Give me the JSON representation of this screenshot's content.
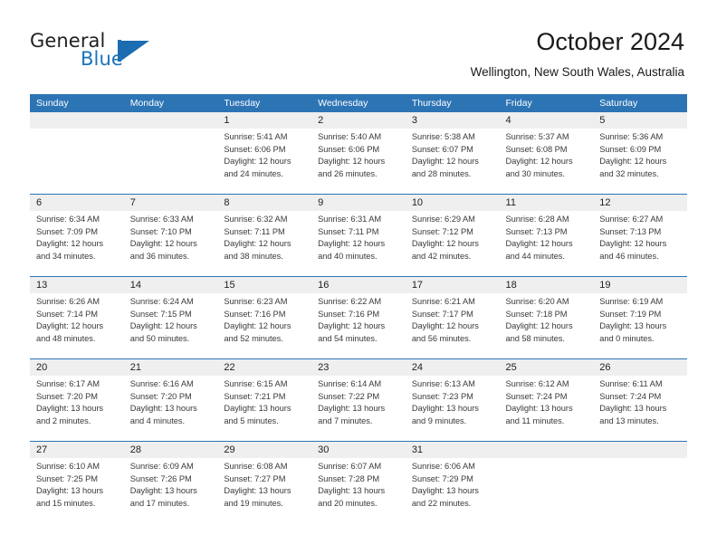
{
  "brand": {
    "name_part1": "General",
    "name_part2": "Blue",
    "logo_icon": "flag-triangle-icon",
    "accent_color": "#1b74bb"
  },
  "header": {
    "title": "October 2024",
    "subtitle": "Wellington, New South Wales, Australia"
  },
  "colors": {
    "header_blue": "#2d74b5",
    "daynum_band": "#efefef",
    "text": "#3a3a3a"
  },
  "weekdays": [
    "Sunday",
    "Monday",
    "Tuesday",
    "Wednesday",
    "Thursday",
    "Friday",
    "Saturday"
  ],
  "weeks": [
    [
      {
        "day": "",
        "lines": []
      },
      {
        "day": "",
        "lines": []
      },
      {
        "day": "1",
        "lines": [
          "Sunrise: 5:41 AM",
          "Sunset: 6:06 PM",
          "Daylight: 12 hours",
          "and 24 minutes."
        ]
      },
      {
        "day": "2",
        "lines": [
          "Sunrise: 5:40 AM",
          "Sunset: 6:06 PM",
          "Daylight: 12 hours",
          "and 26 minutes."
        ]
      },
      {
        "day": "3",
        "lines": [
          "Sunrise: 5:38 AM",
          "Sunset: 6:07 PM",
          "Daylight: 12 hours",
          "and 28 minutes."
        ]
      },
      {
        "day": "4",
        "lines": [
          "Sunrise: 5:37 AM",
          "Sunset: 6:08 PM",
          "Daylight: 12 hours",
          "and 30 minutes."
        ]
      },
      {
        "day": "5",
        "lines": [
          "Sunrise: 5:36 AM",
          "Sunset: 6:09 PM",
          "Daylight: 12 hours",
          "and 32 minutes."
        ]
      }
    ],
    [
      {
        "day": "6",
        "lines": [
          "Sunrise: 6:34 AM",
          "Sunset: 7:09 PM",
          "Daylight: 12 hours",
          "and 34 minutes."
        ]
      },
      {
        "day": "7",
        "lines": [
          "Sunrise: 6:33 AM",
          "Sunset: 7:10 PM",
          "Daylight: 12 hours",
          "and 36 minutes."
        ]
      },
      {
        "day": "8",
        "lines": [
          "Sunrise: 6:32 AM",
          "Sunset: 7:11 PM",
          "Daylight: 12 hours",
          "and 38 minutes."
        ]
      },
      {
        "day": "9",
        "lines": [
          "Sunrise: 6:31 AM",
          "Sunset: 7:11 PM",
          "Daylight: 12 hours",
          "and 40 minutes."
        ]
      },
      {
        "day": "10",
        "lines": [
          "Sunrise: 6:29 AM",
          "Sunset: 7:12 PM",
          "Daylight: 12 hours",
          "and 42 minutes."
        ]
      },
      {
        "day": "11",
        "lines": [
          "Sunrise: 6:28 AM",
          "Sunset: 7:13 PM",
          "Daylight: 12 hours",
          "and 44 minutes."
        ]
      },
      {
        "day": "12",
        "lines": [
          "Sunrise: 6:27 AM",
          "Sunset: 7:13 PM",
          "Daylight: 12 hours",
          "and 46 minutes."
        ]
      }
    ],
    [
      {
        "day": "13",
        "lines": [
          "Sunrise: 6:26 AM",
          "Sunset: 7:14 PM",
          "Daylight: 12 hours",
          "and 48 minutes."
        ]
      },
      {
        "day": "14",
        "lines": [
          "Sunrise: 6:24 AM",
          "Sunset: 7:15 PM",
          "Daylight: 12 hours",
          "and 50 minutes."
        ]
      },
      {
        "day": "15",
        "lines": [
          "Sunrise: 6:23 AM",
          "Sunset: 7:16 PM",
          "Daylight: 12 hours",
          "and 52 minutes."
        ]
      },
      {
        "day": "16",
        "lines": [
          "Sunrise: 6:22 AM",
          "Sunset: 7:16 PM",
          "Daylight: 12 hours",
          "and 54 minutes."
        ]
      },
      {
        "day": "17",
        "lines": [
          "Sunrise: 6:21 AM",
          "Sunset: 7:17 PM",
          "Daylight: 12 hours",
          "and 56 minutes."
        ]
      },
      {
        "day": "18",
        "lines": [
          "Sunrise: 6:20 AM",
          "Sunset: 7:18 PM",
          "Daylight: 12 hours",
          "and 58 minutes."
        ]
      },
      {
        "day": "19",
        "lines": [
          "Sunrise: 6:19 AM",
          "Sunset: 7:19 PM",
          "Daylight: 13 hours",
          "and 0 minutes."
        ]
      }
    ],
    [
      {
        "day": "20",
        "lines": [
          "Sunrise: 6:17 AM",
          "Sunset: 7:20 PM",
          "Daylight: 13 hours",
          "and 2 minutes."
        ]
      },
      {
        "day": "21",
        "lines": [
          "Sunrise: 6:16 AM",
          "Sunset: 7:20 PM",
          "Daylight: 13 hours",
          "and 4 minutes."
        ]
      },
      {
        "day": "22",
        "lines": [
          "Sunrise: 6:15 AM",
          "Sunset: 7:21 PM",
          "Daylight: 13 hours",
          "and 5 minutes."
        ]
      },
      {
        "day": "23",
        "lines": [
          "Sunrise: 6:14 AM",
          "Sunset: 7:22 PM",
          "Daylight: 13 hours",
          "and 7 minutes."
        ]
      },
      {
        "day": "24",
        "lines": [
          "Sunrise: 6:13 AM",
          "Sunset: 7:23 PM",
          "Daylight: 13 hours",
          "and 9 minutes."
        ]
      },
      {
        "day": "25",
        "lines": [
          "Sunrise: 6:12 AM",
          "Sunset: 7:24 PM",
          "Daylight: 13 hours",
          "and 11 minutes."
        ]
      },
      {
        "day": "26",
        "lines": [
          "Sunrise: 6:11 AM",
          "Sunset: 7:24 PM",
          "Daylight: 13 hours",
          "and 13 minutes."
        ]
      }
    ],
    [
      {
        "day": "27",
        "lines": [
          "Sunrise: 6:10 AM",
          "Sunset: 7:25 PM",
          "Daylight: 13 hours",
          "and 15 minutes."
        ]
      },
      {
        "day": "28",
        "lines": [
          "Sunrise: 6:09 AM",
          "Sunset: 7:26 PM",
          "Daylight: 13 hours",
          "and 17 minutes."
        ]
      },
      {
        "day": "29",
        "lines": [
          "Sunrise: 6:08 AM",
          "Sunset: 7:27 PM",
          "Daylight: 13 hours",
          "and 19 minutes."
        ]
      },
      {
        "day": "30",
        "lines": [
          "Sunrise: 6:07 AM",
          "Sunset: 7:28 PM",
          "Daylight: 13 hours",
          "and 20 minutes."
        ]
      },
      {
        "day": "31",
        "lines": [
          "Sunrise: 6:06 AM",
          "Sunset: 7:29 PM",
          "Daylight: 13 hours",
          "and 22 minutes."
        ]
      },
      {
        "day": "",
        "lines": []
      },
      {
        "day": "",
        "lines": []
      }
    ]
  ]
}
